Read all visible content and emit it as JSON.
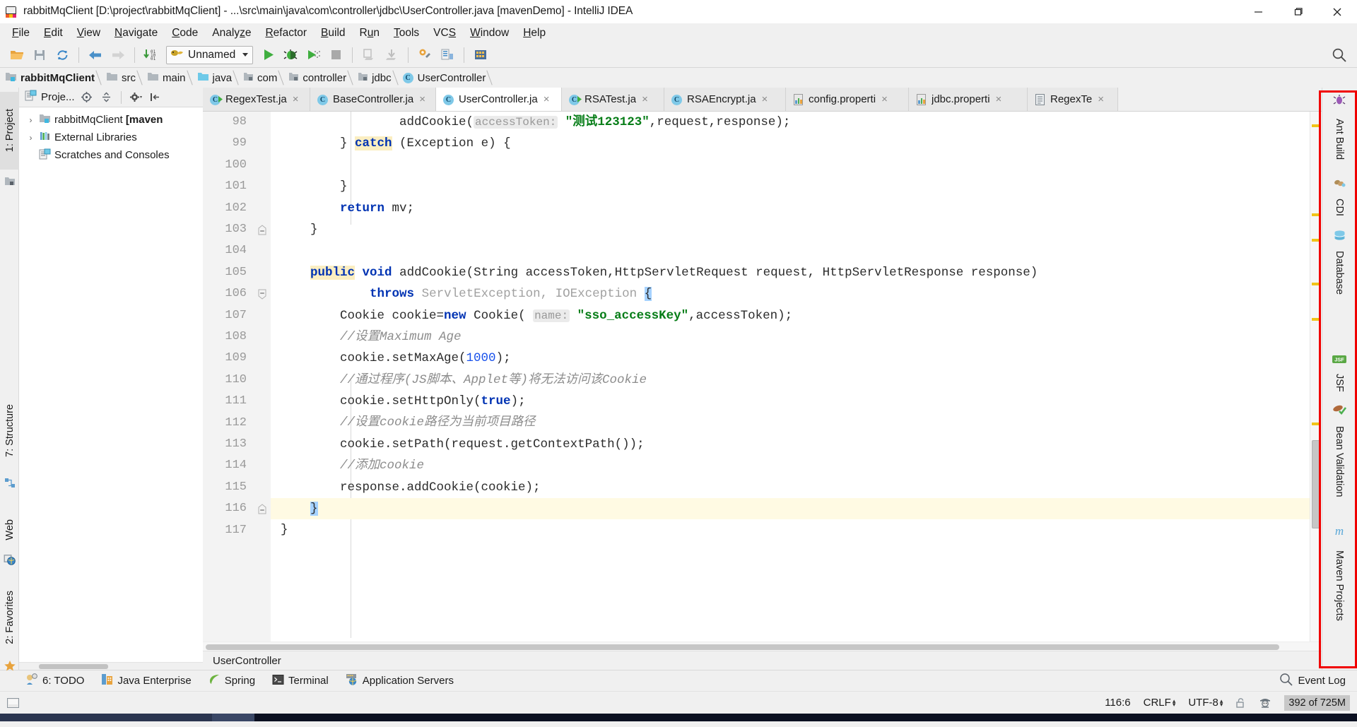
{
  "window": {
    "title": "rabbitMqClient [D:\\project\\rabbitMqClient] - ...\\src\\main\\java\\com\\controller\\jdbc\\UserController.java [mavenDemo] - IntelliJ IDEA",
    "app_icon": "intellij-logo-icon",
    "minimize": "minimize-icon",
    "maximize": "maximize-icon",
    "close": "close-icon"
  },
  "menu": {
    "items": [
      {
        "label": "File",
        "mnemonic": "F"
      },
      {
        "label": "Edit",
        "mnemonic": "E"
      },
      {
        "label": "View",
        "mnemonic": "V"
      },
      {
        "label": "Navigate",
        "mnemonic": "N"
      },
      {
        "label": "Code",
        "mnemonic": "C"
      },
      {
        "label": "Analyze",
        "mnemonic": "z"
      },
      {
        "label": "Refactor",
        "mnemonic": "R"
      },
      {
        "label": "Build",
        "mnemonic": "B"
      },
      {
        "label": "Run",
        "mnemonic": "u"
      },
      {
        "label": "Tools",
        "mnemonic": "T"
      },
      {
        "label": "VCS",
        "mnemonic": "S"
      },
      {
        "label": "Window",
        "mnemonic": "W"
      },
      {
        "label": "Help",
        "mnemonic": "H"
      }
    ]
  },
  "toolbar": {
    "open_icon": "open-folder-icon",
    "save_icon": "save-icon",
    "sync_icon": "synchronize-icon",
    "back_icon": "navigate-back-icon",
    "forward_icon": "navigate-forward-icon",
    "compile_icon": "compile-icon",
    "run_config_name": "Unnamed",
    "run_config_icon": "tomcat-icon",
    "run_icon": "run-icon",
    "debug_icon": "debug-icon",
    "coverage_icon": "run-with-coverage-icon",
    "stop_icon": "stop-icon",
    "update_project_icon": "update-project-icon",
    "commit_icon": "commit-icon",
    "settings_icon": "settings-icon",
    "project_structure_icon": "project-structure-icon",
    "sdk_icon": "sdk-manager-icon",
    "search_icon": "search-everywhere-icon"
  },
  "breadcrumb": {
    "items": [
      {
        "label": "rabbitMqClient",
        "icon": "module-icon"
      },
      {
        "label": "src",
        "icon": "folder-icon"
      },
      {
        "label": "main",
        "icon": "folder-icon"
      },
      {
        "label": "java",
        "icon": "source-root-icon"
      },
      {
        "label": "com",
        "icon": "package-icon"
      },
      {
        "label": "controller",
        "icon": "package-icon"
      },
      {
        "label": "jdbc",
        "icon": "package-icon"
      },
      {
        "label": "UserController",
        "icon": "java-class-icon"
      }
    ]
  },
  "editor_tabs": [
    {
      "label": "RegexTest.ja",
      "icon": "java-class-run-icon",
      "active": false,
      "close": "×"
    },
    {
      "label": "BaseController.ja",
      "icon": "java-class-icon",
      "active": false,
      "close": "×"
    },
    {
      "label": "UserController.ja",
      "icon": "java-class-icon",
      "active": true,
      "close": "×"
    },
    {
      "label": "RSATest.ja",
      "icon": "java-class-run-icon",
      "active": false,
      "close": "×"
    },
    {
      "label": "RSAEncrypt.ja",
      "icon": "java-class-icon",
      "active": false,
      "close": "×"
    },
    {
      "label": "config.properti",
      "icon": "properties-file-icon",
      "active": false,
      "close": "×"
    },
    {
      "label": "jdbc.properti",
      "icon": "properties-file-icon",
      "active": false,
      "close": "×"
    },
    {
      "label": "RegexTe",
      "icon": "text-file-icon",
      "active": false,
      "close": "×"
    }
  ],
  "project_panel": {
    "title": "Proje...",
    "locate_icon": "locate-icon",
    "collapse_icon": "collapse-all-icon",
    "settings_icon": "gear-icon",
    "hide_icon": "hide-panel-icon",
    "tree": [
      {
        "label": "rabbitMqClient ",
        "bold_suffix": "[maven",
        "arrow": "›",
        "icon": "module-icon",
        "indent": 0
      },
      {
        "label": "External Libraries",
        "bold_suffix": "",
        "arrow": "›",
        "icon": "libraries-icon",
        "indent": 0
      },
      {
        "label": "Scratches and Consoles",
        "bold_suffix": "",
        "arrow": "",
        "icon": "scratches-icon",
        "indent": 0
      }
    ]
  },
  "left_strip": {
    "tabs": [
      {
        "label": "1: Project",
        "icon": "project-icon",
        "active": true
      },
      {
        "label": "7: Structure",
        "icon": "structure-icon",
        "active": false
      },
      {
        "label": "Web",
        "icon": "web-icon",
        "active": false
      },
      {
        "label": "2: Favorites",
        "icon": "favorites-star-icon",
        "active": false
      }
    ]
  },
  "right_strip": {
    "tabs": [
      {
        "label": "Ant Build",
        "icon": "ant-icon"
      },
      {
        "label": "CDI",
        "icon": "cdi-icon"
      },
      {
        "label": "Database",
        "icon": "database-icon"
      },
      {
        "label": "JSF",
        "icon": "jsf-icon"
      },
      {
        "label": "Bean Validation",
        "icon": "bean-validation-icon"
      },
      {
        "label": "Maven Projects",
        "icon": "maven-icon"
      }
    ]
  },
  "code": {
    "first_line_number": 98,
    "lines": [
      {
        "n": 98,
        "indent_guides": [
          1
        ],
        "highlight": false,
        "fold": "",
        "tokens": [
          {
            "t": "                addCookie(",
            "c": "plain"
          },
          {
            "t": "accessToken:",
            "c": "hint"
          },
          {
            "t": " ",
            "c": "plain"
          },
          {
            "t": "\"测试123123\"",
            "c": "str"
          },
          {
            "t": ",request,response);",
            "c": "plain"
          }
        ]
      },
      {
        "n": 99,
        "indent_guides": [
          1
        ],
        "highlight": false,
        "fold": "",
        "tokens": [
          {
            "t": "        } ",
            "c": "plain"
          },
          {
            "t": "catch",
            "c": "kw-hl"
          },
          {
            "t": " (Exception e) {",
            "c": "plain"
          }
        ]
      },
      {
        "n": 100,
        "indent_guides": [
          1
        ],
        "highlight": false,
        "fold": "",
        "tokens": [
          {
            "t": "",
            "c": "plain"
          }
        ]
      },
      {
        "n": 101,
        "indent_guides": [
          1
        ],
        "highlight": false,
        "fold": "",
        "tokens": [
          {
            "t": "        }",
            "c": "plain"
          }
        ]
      },
      {
        "n": 102,
        "indent_guides": [
          1
        ],
        "highlight": false,
        "fold": "",
        "tokens": [
          {
            "t": "        ",
            "c": "plain"
          },
          {
            "t": "return",
            "c": "kw"
          },
          {
            "t": " mv;",
            "c": "plain"
          }
        ]
      },
      {
        "n": 103,
        "indent_guides": [],
        "highlight": false,
        "fold": "collapse",
        "tokens": [
          {
            "t": "    }",
            "c": "plain"
          }
        ]
      },
      {
        "n": 104,
        "indent_guides": [],
        "highlight": false,
        "fold": "",
        "tokens": [
          {
            "t": "",
            "c": "plain"
          }
        ]
      },
      {
        "n": 105,
        "indent_guides": [],
        "highlight": false,
        "fold": "",
        "tokens": [
          {
            "t": "    ",
            "c": "plain"
          },
          {
            "t": "public",
            "c": "kw-hl"
          },
          {
            "t": " ",
            "c": "plain"
          },
          {
            "t": "void",
            "c": "kw"
          },
          {
            "t": " addCookie(String accessToken,HttpServletRequest request, HttpServletResponse response)",
            "c": "plain"
          }
        ]
      },
      {
        "n": 106,
        "indent_guides": [
          1
        ],
        "highlight": false,
        "fold": "collapse-open",
        "tokens": [
          {
            "t": "            ",
            "c": "plain"
          },
          {
            "t": "throws",
            "c": "kw"
          },
          {
            "t": " ",
            "c": "plain"
          },
          {
            "t": "ServletException, IOException ",
            "c": "typ"
          },
          {
            "t": "{",
            "c": "sel"
          }
        ]
      },
      {
        "n": 107,
        "indent_guides": [
          1
        ],
        "highlight": false,
        "fold": "",
        "tokens": [
          {
            "t": "        Cookie cookie=",
            "c": "plain"
          },
          {
            "t": "new",
            "c": "kw"
          },
          {
            "t": " Cookie( ",
            "c": "plain"
          },
          {
            "t": "name:",
            "c": "hint"
          },
          {
            "t": " ",
            "c": "plain"
          },
          {
            "t": "\"sso_accessKey\"",
            "c": "str"
          },
          {
            "t": ",accessToken);",
            "c": "plain"
          }
        ]
      },
      {
        "n": 108,
        "indent_guides": [
          1
        ],
        "highlight": false,
        "fold": "",
        "tokens": [
          {
            "t": "        //设置Maximum Age",
            "c": "cmt"
          }
        ]
      },
      {
        "n": 109,
        "indent_guides": [
          1
        ],
        "highlight": false,
        "fold": "",
        "tokens": [
          {
            "t": "        cookie.setMaxAge(",
            "c": "plain"
          },
          {
            "t": "1000",
            "c": "num"
          },
          {
            "t": ");",
            "c": "plain"
          }
        ]
      },
      {
        "n": 110,
        "indent_guides": [
          1
        ],
        "highlight": false,
        "fold": "",
        "tokens": [
          {
            "t": "        //通过程序(JS脚本、Applet等)将无法访问该Cookie",
            "c": "cmt"
          }
        ]
      },
      {
        "n": 111,
        "indent_guides": [
          1
        ],
        "highlight": false,
        "fold": "",
        "tokens": [
          {
            "t": "        cookie.setHttpOnly(",
            "c": "plain"
          },
          {
            "t": "true",
            "c": "kw"
          },
          {
            "t": ");",
            "c": "plain"
          }
        ]
      },
      {
        "n": 112,
        "indent_guides": [
          1
        ],
        "highlight": false,
        "fold": "",
        "tokens": [
          {
            "t": "        //设置cookie路径为当前项目路径",
            "c": "cmt"
          }
        ]
      },
      {
        "n": 113,
        "indent_guides": [
          1
        ],
        "highlight": false,
        "fold": "",
        "tokens": [
          {
            "t": "        cookie.setPath(request.getContextPath());",
            "c": "plain"
          }
        ]
      },
      {
        "n": 114,
        "indent_guides": [
          1
        ],
        "highlight": false,
        "fold": "",
        "tokens": [
          {
            "t": "        //添加cookie",
            "c": "cmt"
          }
        ]
      },
      {
        "n": 115,
        "indent_guides": [
          1
        ],
        "highlight": false,
        "fold": "",
        "tokens": [
          {
            "t": "        response.addCookie(cookie);",
            "c": "plain"
          }
        ]
      },
      {
        "n": 116,
        "indent_guides": [],
        "highlight": true,
        "fold": "collapse",
        "tokens": [
          {
            "t": "    ",
            "c": "plain"
          },
          {
            "t": "}",
            "c": "sel"
          }
        ]
      },
      {
        "n": 117,
        "indent_guides": [],
        "highlight": false,
        "fold": "",
        "tokens": [
          {
            "t": "}",
            "c": "plain"
          }
        ]
      }
    ]
  },
  "editor_status": {
    "label": "UserController"
  },
  "bottom_bar": {
    "items": [
      {
        "label": "6: TODO",
        "icon": "todo-icon"
      },
      {
        "label": "Java Enterprise",
        "icon": "java-enterprise-icon"
      },
      {
        "label": "Spring",
        "icon": "spring-leaf-icon"
      },
      {
        "label": "Terminal",
        "icon": "terminal-icon"
      },
      {
        "label": "Application Servers",
        "icon": "application-servers-icon"
      }
    ],
    "event_log": "Event Log",
    "event_log_icon": "event-log-icon"
  },
  "status_bar": {
    "position": "116:6",
    "line_separator": "CRLF",
    "encoding": "UTF-8",
    "lock_icon": "unlocked-icon",
    "inspection_icon": "inspection-hector-icon",
    "memory": "392 of 725M"
  },
  "colors": {
    "accent_blue": "#7fc9e8",
    "keyword_blue": "#0033b3",
    "string_green": "#067d17",
    "number_blue": "#1750eb",
    "comment_gray": "#8c8c8c",
    "highlight_yellow": "#fffae3",
    "selection_blue": "#a6d2ff",
    "annotation_red": "#f00000",
    "window_bg": "#f0f0f0"
  }
}
